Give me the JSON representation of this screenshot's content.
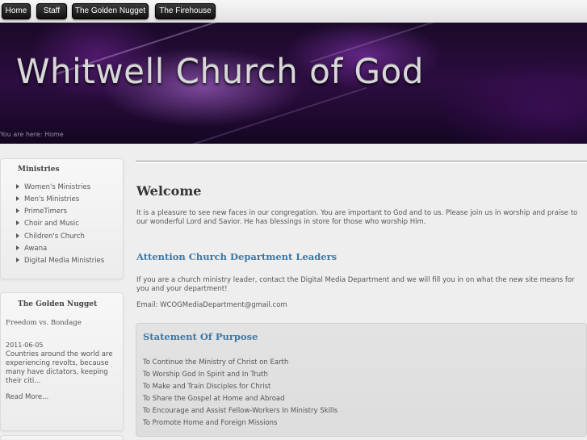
{
  "nav": {
    "items": [
      {
        "label": "Home"
      },
      {
        "label": "Staff"
      },
      {
        "label": "The Golden Nugget"
      },
      {
        "label": "The Firehouse"
      }
    ]
  },
  "banner": {
    "title": "Whitwell Church of God",
    "breadcrumb_prefix": "You are here:",
    "breadcrumb_current": "Home"
  },
  "sidebar": {
    "ministries": {
      "title": "Ministries",
      "items": [
        "Women's Ministries",
        "Men's Ministries",
        "PrimeTimers",
        "Choir and Music",
        "Children's Church",
        "Awana",
        "Digital Media Ministries"
      ]
    },
    "golden_nugget": {
      "title": "The Golden Nugget",
      "article_title": "Freedom vs. Bondage",
      "date": "2011-06-05",
      "excerpt": "Countries around the world are experiencing revolts, because many have dictators, keeping their citi...",
      "read_more": "Read More..."
    }
  },
  "main": {
    "welcome_title": "Welcome",
    "welcome_text": "It is a pleasure to see new faces in our congregation. You are important to God and to us. Please join us in worship and praise to our wonderful Lord and Savior. He has blessings in store for those who worship Him.",
    "attention_title": "Attention Church Department Leaders",
    "attention_text": "If you are a church ministry leader, contact the Digital Media Department and we will fill you in on what the new site means for you and your department!",
    "email_line": "Email: WCOGMediaDepartment@gmail.com",
    "purpose_title": "Statement Of Purpose",
    "purpose_items": [
      "To Continue the Ministry of Christ on Earth",
      "To Worship God In Spirit and In Truth",
      "To Make and Train Disciples for Christ",
      "To Share the Gospel at Home and Abroad",
      "To Encourage and Assist Fellow-Workers In Ministry Skills",
      "To Promote Home and Foreign Missions"
    ]
  },
  "colors": {
    "heading_blue": "#3a78a8",
    "nav_button": "#1a1a1a",
    "banner_purple": "#2c0d40"
  }
}
